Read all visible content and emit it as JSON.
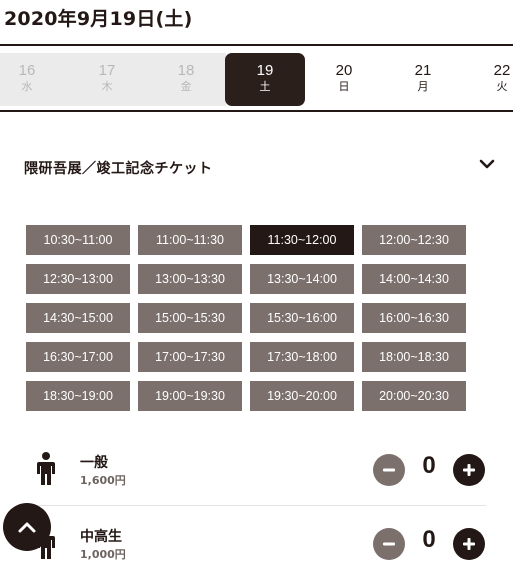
{
  "page_title": "2020年9月19日(土)",
  "dates": [
    {
      "day": "16",
      "weekday": "水",
      "state": "past"
    },
    {
      "day": "17",
      "weekday": "木",
      "state": "past"
    },
    {
      "day": "18",
      "weekday": "金",
      "state": "past"
    },
    {
      "day": "19",
      "weekday": "土",
      "state": "selected"
    },
    {
      "day": "20",
      "weekday": "日",
      "state": "future"
    },
    {
      "day": "21",
      "weekday": "月",
      "state": "future"
    },
    {
      "day": "22",
      "weekday": "火",
      "state": "future"
    }
  ],
  "ticket": {
    "name": "隈研吾展／竣工記念チケット",
    "toggle_icon": "chevron-down-icon"
  },
  "time_slots": [
    "10:30~11:00",
    "11:00~11:30",
    "11:30~12:00",
    "12:00~12:30",
    "12:30~13:00",
    "13:00~13:30",
    "13:30~14:00",
    "14:00~14:30",
    "14:30~15:00",
    "15:00~15:30",
    "15:30~16:00",
    "16:00~16:30",
    "16:30~17:00",
    "17:00~17:30",
    "17:30~18:00",
    "18:00~18:30",
    "18:30~19:00",
    "19:00~19:30",
    "19:30~20:00",
    "20:00~20:30"
  ],
  "selected_slot": "11:30~12:00",
  "ticket_types": [
    {
      "name": "一般",
      "price": "1,600円",
      "quantity": "0",
      "icon": "person-icon"
    },
    {
      "name": "中高生",
      "price": "1,000円",
      "quantity": "0",
      "icon": "person-icon"
    }
  ],
  "colors": {
    "dark": "#231815",
    "slot_gray": "#7b706c",
    "past_bg": "#ebebeb",
    "past_text": "#b8b8b8"
  },
  "scroll_top_icon": "chevron-up-icon"
}
